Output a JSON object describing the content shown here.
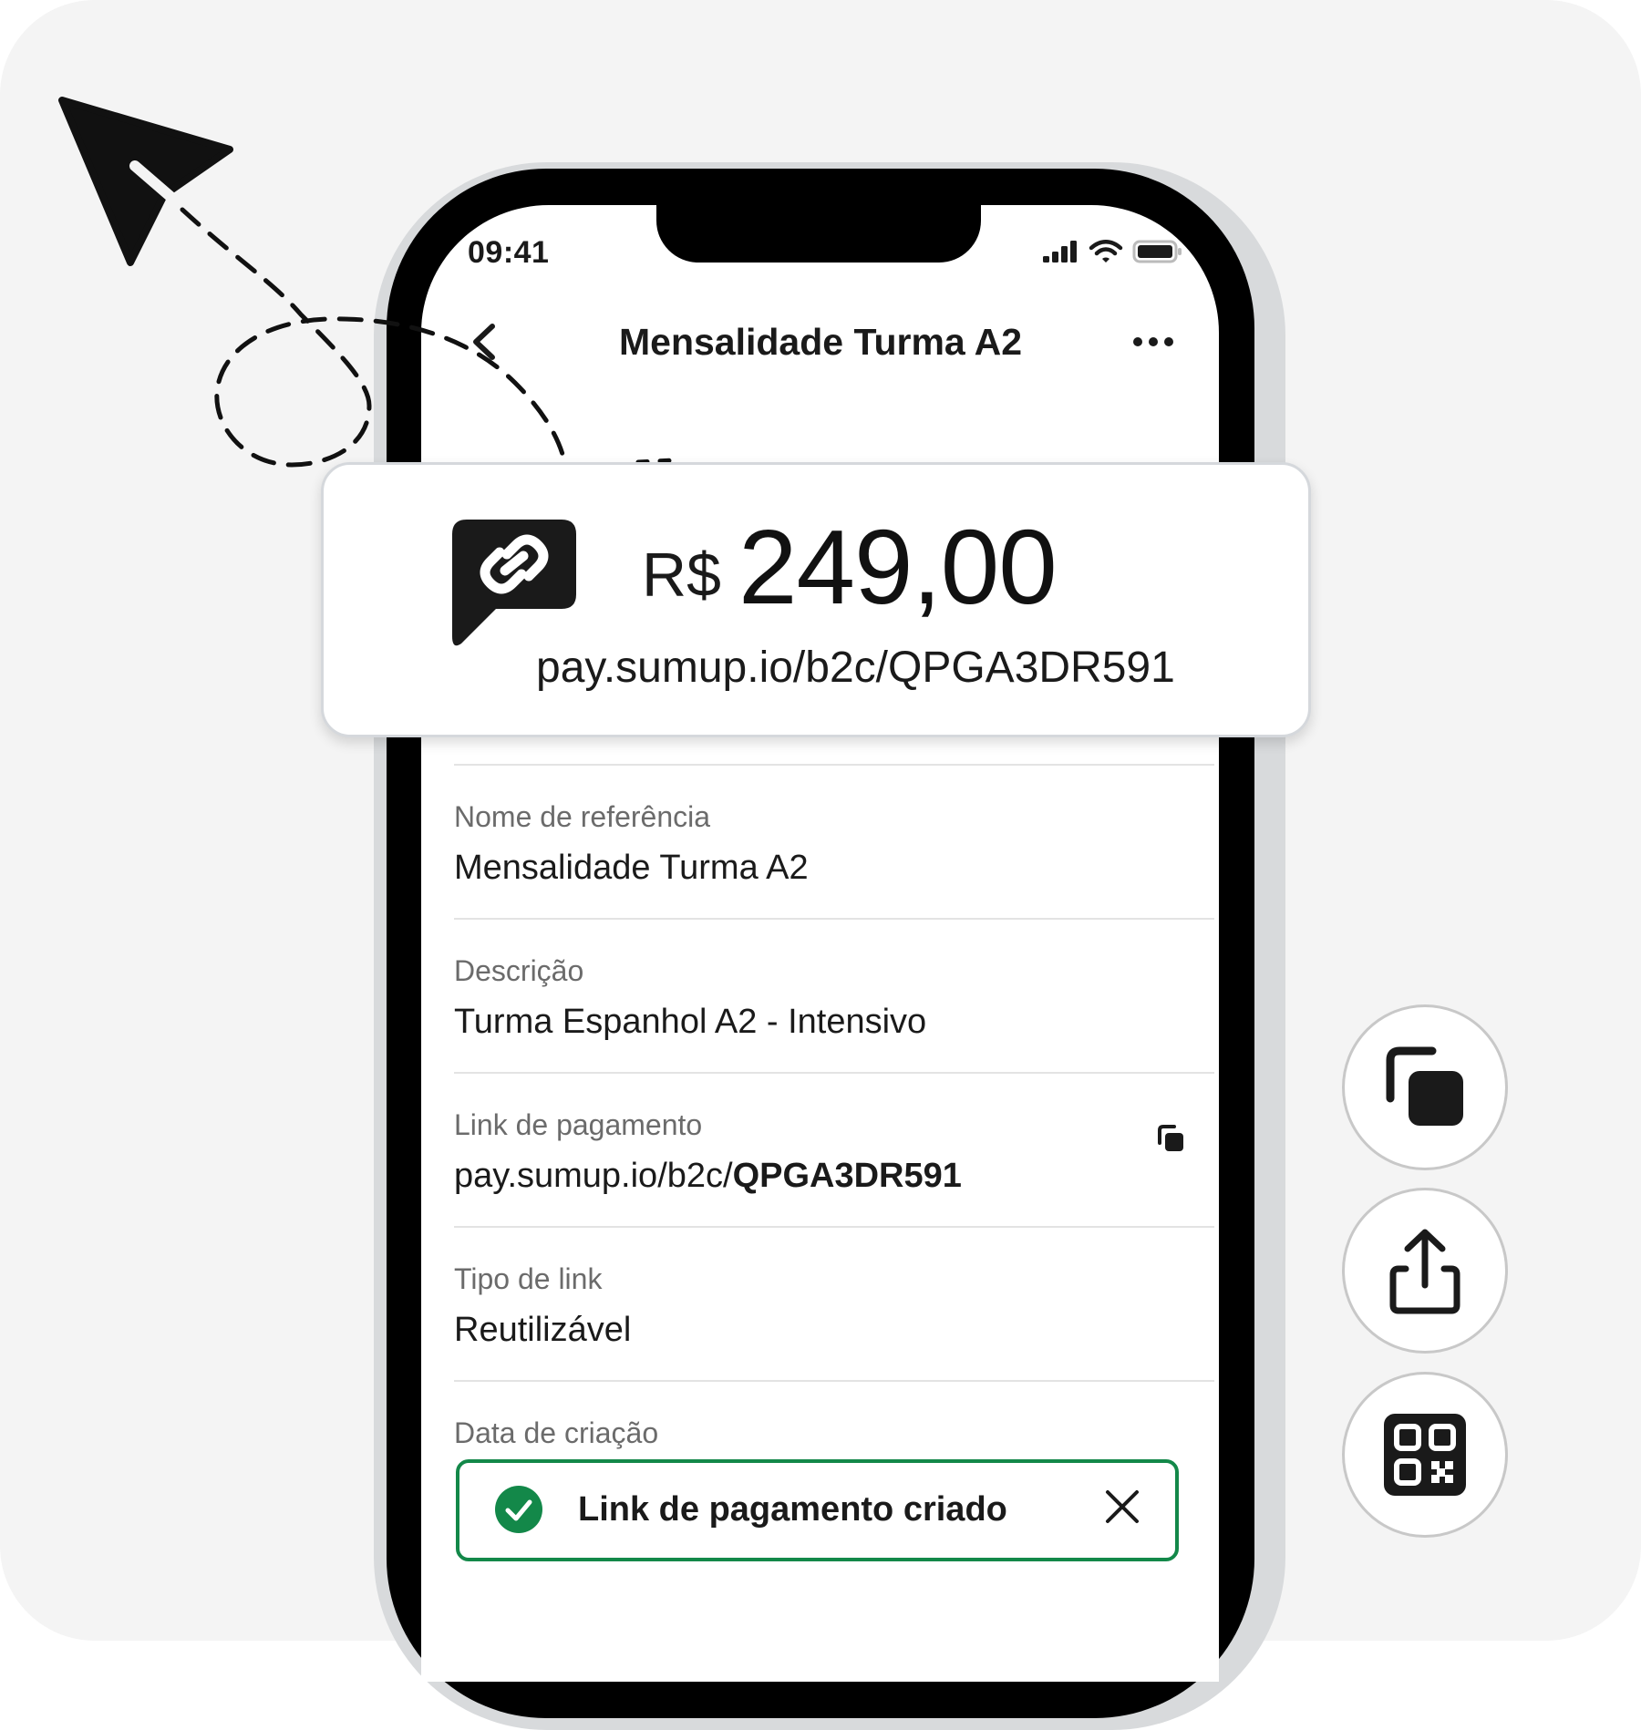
{
  "status_bar": {
    "time": "09:41"
  },
  "nav": {
    "title": "Mensalidade Turma A2"
  },
  "amount_card": {
    "currency": "R$",
    "amount": "249,00",
    "url": "pay.sumup.io/b2c/QPGA3DR591"
  },
  "details": {
    "reference_label": "Nome de referência",
    "reference_value": "Mensalidade Turma A2",
    "description_label": "Descrição",
    "description_value": "Turma Espanhol A2 - Intensivo",
    "link_label": "Link de pagamento",
    "link_prefix": "pay.sumup.io/b2c/",
    "link_code": "QPGA3DR591",
    "type_label": "Tipo de link",
    "type_value": "Reutilizável",
    "created_label": "Data de criação"
  },
  "toast": {
    "message": "Link de pagamento criado"
  },
  "icons": [
    "back-chevron-icon",
    "more-icon",
    "link-bubble-icon",
    "copy-icon",
    "share-icon",
    "qr-code-icon",
    "check-circle-icon",
    "close-icon",
    "paper-plane-icon"
  ],
  "colors": {
    "success": "#138849",
    "dark": "#1a1a1a",
    "background": "#f4f4f4"
  }
}
